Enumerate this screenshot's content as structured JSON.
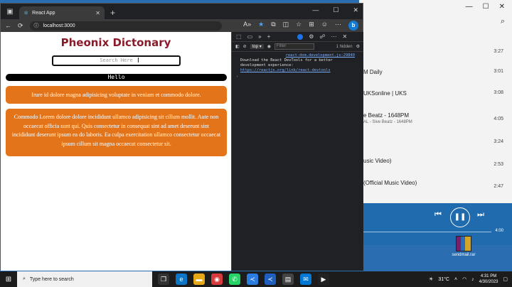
{
  "browser": {
    "tab_title": "React App",
    "url": "localhost:3000"
  },
  "page": {
    "title": "Pheonix Dictonary",
    "search_placeholder": "Search Here",
    "hello_text": "Hello",
    "card1_text": "Irure id dolore magna adipisicing voluptate in veniam et commodo dolore.",
    "card2_text": "Commodo Lorem dolore dolore incididunt ullamco adipisicing sit cillum mollit. Aute non occaecat officia sunt qui. Quis consectetur in consequat sint ad amet deserunt sint incididunt deserunt ipsum ea do laboris. Ea culpa exercitation ullamco consectetur occaecat ipsum cillum sit magna occaecat consectetur sit."
  },
  "devtools": {
    "context": "top",
    "filter_placeholder": "Filter",
    "hidden_count": "1 hidden",
    "console_source": "react-dom.development.js:29840",
    "console_message": "Download the React DevTools for a better development experience:",
    "console_link": "https://reactjs.org/link/react-devtools"
  },
  "music": {
    "tracks": [
      {
        "title": "",
        "sub": "",
        "duration": "3:27"
      },
      {
        "title": "M Daily",
        "sub": "",
        "duration": "3:01"
      },
      {
        "title": "UKSonline | UKS",
        "sub": "",
        "duration": "3:08"
      },
      {
        "title": "e Beatz - 1648PM",
        "sub": "AL - Sive Beatz - 1648PM",
        "duration": "4:05"
      },
      {
        "title": "",
        "sub": "",
        "duration": "3:24"
      },
      {
        "title": "usic Video)",
        "sub": "",
        "duration": "2:53"
      },
      {
        "title": "(Official Music Video)",
        "sub": "",
        "duration": "2:47"
      }
    ],
    "player_time": "4:00"
  },
  "desktop": {
    "winrar_label": "sendmail.rar"
  },
  "taskbar": {
    "search_placeholder": "Type here to search",
    "weather": "31°C",
    "time": "4:31 PM",
    "date": "4/30/2023"
  }
}
